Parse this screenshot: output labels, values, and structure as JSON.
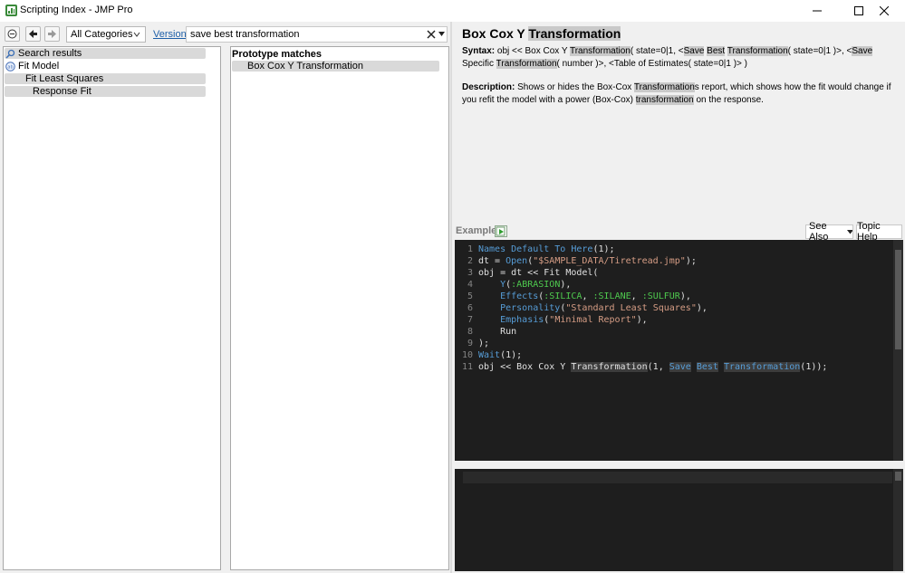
{
  "window": {
    "title": "Scripting Index - JMP Pro",
    "icon": "jmp-scripting-index-icon",
    "controls": [
      "minimize",
      "maximize",
      "close"
    ]
  },
  "toolbar": {
    "category": "All Categories",
    "version_link": "Version",
    "search_value": "save best transformation",
    "icons": [
      "collapse-icon",
      "back-arrow-icon",
      "forward-arrow-icon",
      "clear-icon",
      "dropdown-icon"
    ]
  },
  "tree": {
    "items": [
      {
        "label": "Search results",
        "icon": "search-icon",
        "selected": true
      },
      {
        "label": "Fit Model",
        "icon": "fit-model-icon",
        "selected": false
      },
      {
        "label": "Fit Least Squares",
        "selected": true
      },
      {
        "label": "Response Fit",
        "selected": true
      }
    ]
  },
  "matches": {
    "header": "Prototype matches",
    "items": [
      "Box Cox Y Transformation"
    ]
  },
  "detail": {
    "heading_prefix": "Box Cox Y",
    "heading_highlight": "Transformation",
    "syntax_label": "Syntax:",
    "syntax_parts": [
      {
        "t": "obj << Box Cox Y ",
        "h": false
      },
      {
        "t": "Transformation",
        "h": true
      },
      {
        "t": "( state=0|1, <",
        "h": false
      },
      {
        "t": "Save",
        "h": true
      },
      {
        "t": " ",
        "h": false
      },
      {
        "t": "Best",
        "h": true
      },
      {
        "t": " ",
        "h": false
      },
      {
        "t": "Transformation",
        "h": true
      },
      {
        "t": "( state=0|1 )>, <",
        "h": false
      },
      {
        "t": "Save",
        "h": true
      },
      {
        "t": " Specific ",
        "h": false
      },
      {
        "t": "T",
        "h": true
      },
      {
        "t": "ransformation",
        "h": true
      },
      {
        "t": "( number )>, <Table of Estimates( state=0|1 )> )",
        "h": false
      }
    ],
    "description_label": "Description:",
    "description_parts": [
      {
        "t": "Shows or hides the Box-Cox ",
        "h": false
      },
      {
        "t": "Transformation",
        "h": true
      },
      {
        "t": "s report, which shows how the fit would change if you refit the model with a power (Box-Cox) ",
        "h": false
      },
      {
        "t": "transformation",
        "h": true
      },
      {
        "t": " on the response.",
        "h": false
      }
    ]
  },
  "example": {
    "label": "Example",
    "see_also": "See Also",
    "topic_help": "Topic Help",
    "lines": [
      {
        "n": "1",
        "parts": [
          {
            "t": "Names Default To Here",
            "c": "k"
          },
          {
            "t": "(1);",
            "c": "w"
          }
        ]
      },
      {
        "n": "2",
        "parts": [
          {
            "t": "dt = ",
            "c": "w"
          },
          {
            "t": "Open",
            "c": "k"
          },
          {
            "t": "(",
            "c": "w"
          },
          {
            "t": "\"$SAMPLE_DATA/Tiretread.jmp\"",
            "c": "s"
          },
          {
            "t": ");",
            "c": "w"
          }
        ]
      },
      {
        "n": "3",
        "parts": [
          {
            "t": "obj = dt << Fit Model(",
            "c": "w"
          }
        ]
      },
      {
        "n": "4",
        "parts": [
          {
            "t": "    ",
            "c": "w"
          },
          {
            "t": "Y",
            "c": "k"
          },
          {
            "t": "(",
            "c": "w"
          },
          {
            "t": ":ABRASION",
            "c": "g"
          },
          {
            "t": "),",
            "c": "w"
          }
        ]
      },
      {
        "n": "5",
        "parts": [
          {
            "t": "    ",
            "c": "w"
          },
          {
            "t": "Effects",
            "c": "k"
          },
          {
            "t": "(",
            "c": "w"
          },
          {
            "t": ":SILICA",
            "c": "g"
          },
          {
            "t": ", ",
            "c": "w"
          },
          {
            "t": ":SILANE",
            "c": "g"
          },
          {
            "t": ", ",
            "c": "w"
          },
          {
            "t": ":SULFUR",
            "c": "g"
          },
          {
            "t": "),",
            "c": "w"
          }
        ]
      },
      {
        "n": "6",
        "parts": [
          {
            "t": "    ",
            "c": "w"
          },
          {
            "t": "Personality",
            "c": "k"
          },
          {
            "t": "(",
            "c": "w"
          },
          {
            "t": "\"Standard Least Squares\"",
            "c": "s"
          },
          {
            "t": "),",
            "c": "w"
          }
        ]
      },
      {
        "n": "7",
        "parts": [
          {
            "t": "    ",
            "c": "w"
          },
          {
            "t": "Emphasis",
            "c": "k"
          },
          {
            "t": "(",
            "c": "w"
          },
          {
            "t": "\"Minimal Report\"",
            "c": "s"
          },
          {
            "t": "),",
            "c": "w"
          }
        ]
      },
      {
        "n": "8",
        "parts": [
          {
            "t": "    Run",
            "c": "w"
          }
        ]
      },
      {
        "n": "9",
        "parts": [
          {
            "t": ");",
            "c": "w"
          }
        ]
      },
      {
        "n": "10",
        "parts": [
          {
            "t": "Wait",
            "c": "k"
          },
          {
            "t": "(1);",
            "c": "w"
          }
        ]
      },
      {
        "n": "11",
        "parts": [
          {
            "t": "obj << Box Cox Y ",
            "c": "w"
          },
          {
            "t": "Transformation",
            "c": "w hl2"
          },
          {
            "t": "(1, ",
            "c": "w"
          },
          {
            "t": "Save",
            "c": "k hl2"
          },
          {
            "t": " ",
            "c": "w"
          },
          {
            "t": "Best",
            "c": "k hl2"
          },
          {
            "t": " ",
            "c": "w"
          },
          {
            "t": "Transformation",
            "c": "k hl2"
          },
          {
            "t": "(1));",
            "c": "w"
          }
        ]
      }
    ]
  }
}
